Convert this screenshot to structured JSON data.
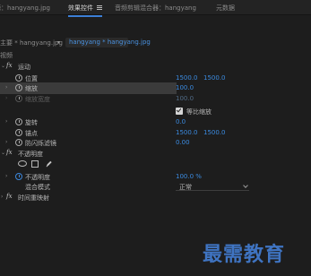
{
  "tabs": [
    {
      "label": "源：hangyang.jpg",
      "active": false
    },
    {
      "label": "效果控件",
      "active": true
    },
    {
      "label": "音频剪辑混合器：hangyang",
      "active": false
    },
    {
      "label": "元数据",
      "active": false
    }
  ],
  "clip_bar": {
    "master": "主要 * hangyang.jpg",
    "sequence": "hangyang * hangyang.jpg"
  },
  "section_label": "视频",
  "motion": {
    "name": "运动",
    "position": {
      "label": "位置",
      "x": "1500.0",
      "y": "1500.0"
    },
    "scale": {
      "label": "缩放",
      "value": "100.0"
    },
    "scale_width": {
      "label": "缩放宽度",
      "value": "100.0"
    },
    "uniform_scale": {
      "label": "等比缩放",
      "checked": true
    },
    "rotation": {
      "label": "旋转",
      "value": "0.0"
    },
    "anchor": {
      "label": "锚点",
      "x": "1500.0",
      "y": "1500.0"
    },
    "antiflicker": {
      "label": "防闪烁滤镜",
      "value": "0.00"
    }
  },
  "opacity": {
    "name": "不透明度",
    "value_label": "不透明度",
    "value": "100.0 %",
    "blend_label": "混合模式",
    "blend_value": "正常"
  },
  "time_remap": {
    "name": "时间重映射"
  },
  "watermark": "最需教育",
  "colors": {
    "accent": "#3b8be0",
    "panel_bg": "#1d1d1d",
    "highlight_row": "#3b3b3b",
    "watermark": "#3f74c2"
  }
}
